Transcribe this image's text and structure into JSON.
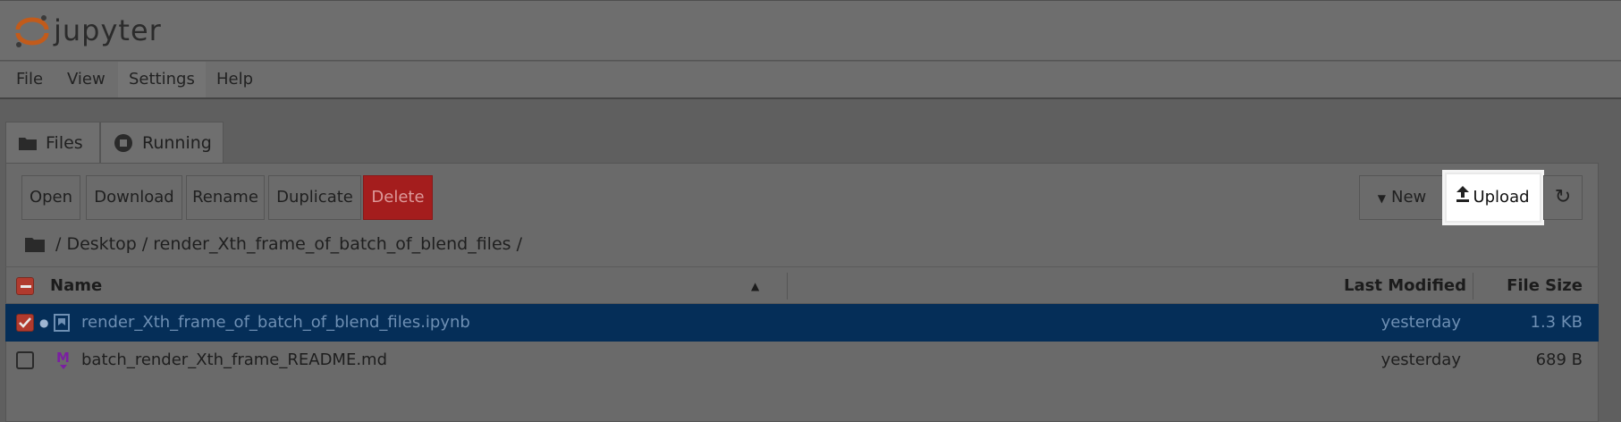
{
  "app": {
    "logo_text": "jupyter"
  },
  "menu": [
    "File",
    "View",
    "Settings",
    "Help"
  ],
  "tabs": [
    {
      "label": "Files",
      "icon": "folder-icon"
    },
    {
      "label": "Running",
      "icon": "stop-circle-icon"
    }
  ],
  "toolbar": {
    "open": "Open",
    "download": "Download",
    "rename": "Rename",
    "duplicate": "Duplicate",
    "delete": "Delete",
    "new": "New",
    "upload": "Upload"
  },
  "breadcrumb": "/ Desktop / render_Xth_frame_of_batch_of_blend_files /",
  "columns": {
    "name": "Name",
    "modified": "Last Modified",
    "size": "File Size"
  },
  "files": [
    {
      "name": "render_Xth_frame_of_batch_of_blend_files.ipynb",
      "modified": "yesterday",
      "size": "1.3 KB",
      "selected": true,
      "icon": "notebook-icon"
    },
    {
      "name": "batch_render_Xth_frame_README.md",
      "modified": "yesterday",
      "size": "689 B",
      "selected": false,
      "icon": "markdown-icon"
    }
  ],
  "colors": {
    "delete_bg": "#a41d1d",
    "selected_row": "#052e58",
    "checkbox_accent": "#c0392b",
    "markdown": "#7b1fa2"
  }
}
